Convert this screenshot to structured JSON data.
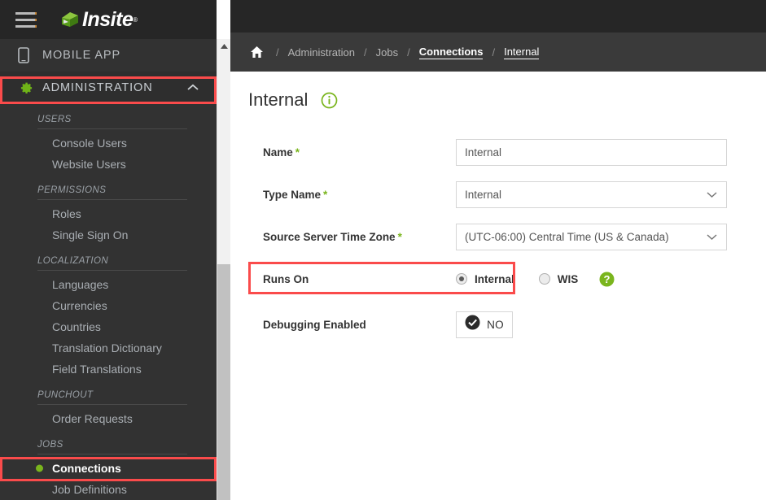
{
  "brand": {
    "name": "Insite",
    "trademark": "®",
    "accent_green": "#7ab51d",
    "highlight_red": "#fa4b4b"
  },
  "sidebar": {
    "menu_icon": "hamburger-icon",
    "top_items": [
      {
        "label": "MOBILE APP",
        "icon": "mobile-phone-icon"
      },
      {
        "label": "ADMINISTRATION",
        "icon": "gear-icon",
        "expanded": true,
        "chevron": "chevron-up-icon"
      }
    ],
    "groups": [
      {
        "title": "USERS",
        "links": [
          {
            "label": "Console Users",
            "active": false
          },
          {
            "label": "Website Users",
            "active": false
          }
        ]
      },
      {
        "title": "PERMISSIONS",
        "links": [
          {
            "label": "Roles",
            "active": false
          },
          {
            "label": "Single Sign On",
            "active": false
          }
        ]
      },
      {
        "title": "LOCALIZATION",
        "links": [
          {
            "label": "Languages",
            "active": false
          },
          {
            "label": "Currencies",
            "active": false
          },
          {
            "label": "Countries",
            "active": false
          },
          {
            "label": "Translation Dictionary",
            "active": false
          },
          {
            "label": "Field Translations",
            "active": false
          }
        ]
      },
      {
        "title": "PUNCHOUT",
        "links": [
          {
            "label": "Order Requests",
            "active": false
          }
        ]
      },
      {
        "title": "JOBS",
        "links": [
          {
            "label": "Connections",
            "active": true
          },
          {
            "label": "Job Definitions",
            "active": false
          }
        ]
      }
    ]
  },
  "breadcrumb": {
    "home_icon": "home-icon",
    "separator": "/",
    "items": [
      {
        "label": "Administration",
        "style": "plain"
      },
      {
        "label": "Jobs",
        "style": "plain"
      },
      {
        "label": "Connections",
        "style": "strong"
      },
      {
        "label": "Internal",
        "style": "current"
      }
    ]
  },
  "page": {
    "title": "Internal",
    "info_icon": "info-circle-icon"
  },
  "form": {
    "required_marker": "*",
    "fields": {
      "name": {
        "label": "Name",
        "required": true,
        "value": "Internal",
        "placeholder": "Internal"
      },
      "type_name": {
        "label": "Type Name",
        "required": true,
        "value": "Internal",
        "caret": "chevron-down-icon"
      },
      "time_zone": {
        "label": "Source Server Time Zone",
        "required": true,
        "value": "(UTC-06:00) Central Time (US & Canada)",
        "caret": "chevron-down-icon"
      },
      "runs_on": {
        "label": "Runs On",
        "required": false,
        "options": [
          {
            "label": "Internal",
            "selected": true
          },
          {
            "label": "WIS",
            "selected": false
          }
        ],
        "help_icon": "help-circle-icon"
      },
      "debugging_enabled": {
        "label": "Debugging Enabled",
        "required": false,
        "toggle_value": "NO",
        "toggle_icon": "check-circle-icon"
      }
    }
  },
  "scrollbar": {
    "arrow_up": "scroll-up-arrow-icon"
  }
}
